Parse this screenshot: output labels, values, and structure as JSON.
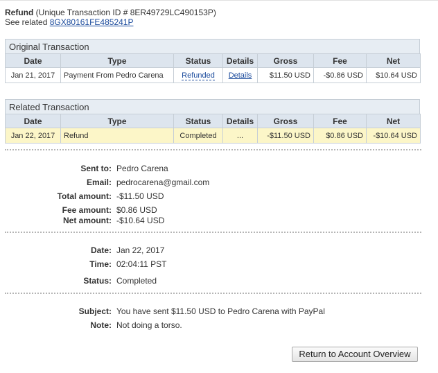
{
  "header": {
    "type_label": "Refund",
    "txn_text": " (Unique Transaction ID # 8ER49729LC490153P)",
    "see_related_label": "See related ",
    "related_id": "8GX80161FE485241P"
  },
  "columns": [
    "Date",
    "Type",
    "Status",
    "Details",
    "Gross",
    "Fee",
    "Net"
  ],
  "original": {
    "title": "Original Transaction",
    "row": {
      "date": "Jan 21, 2017",
      "type": "Payment From Pedro Carena",
      "status": "Refunded",
      "details": "Details",
      "gross": "$11.50 USD",
      "fee": "-$0.86 USD",
      "net": "$10.64 USD"
    }
  },
  "related": {
    "title": "Related Transaction",
    "row": {
      "date": "Jan 22, 2017",
      "type": "Refund",
      "status": "Completed",
      "details": "...",
      "gross": "-$11.50 USD",
      "fee": "$0.86 USD",
      "net": "-$10.64 USD"
    }
  },
  "info1": {
    "sent_to_label": "Sent to:",
    "sent_to": "Pedro Carena",
    "email_label": "Email:",
    "email": "pedrocarena@gmail.com",
    "total_label": "Total amount:",
    "total": "-$11.50 USD",
    "fee_label": "Fee amount:",
    "fee": "$0.86 USD",
    "net_label": "Net amount:",
    "net": "-$10.64 USD"
  },
  "info2": {
    "date_label": "Date:",
    "date": "Jan 22, 2017",
    "time_label": "Time:",
    "time": "02:04:11 PST",
    "status_label": "Status:",
    "status": "Completed"
  },
  "info3": {
    "subject_label": "Subject:",
    "subject": "You have sent $11.50 USD to Pedro Carena with PayPal",
    "note_label": "Note:",
    "note": "Not doing a torso."
  },
  "button": {
    "label": "Return to Account Overview"
  },
  "colors": {
    "link": "#1a4a9c",
    "header_bg": "#dde5ee",
    "highlight_row": "#fcf6c8"
  }
}
